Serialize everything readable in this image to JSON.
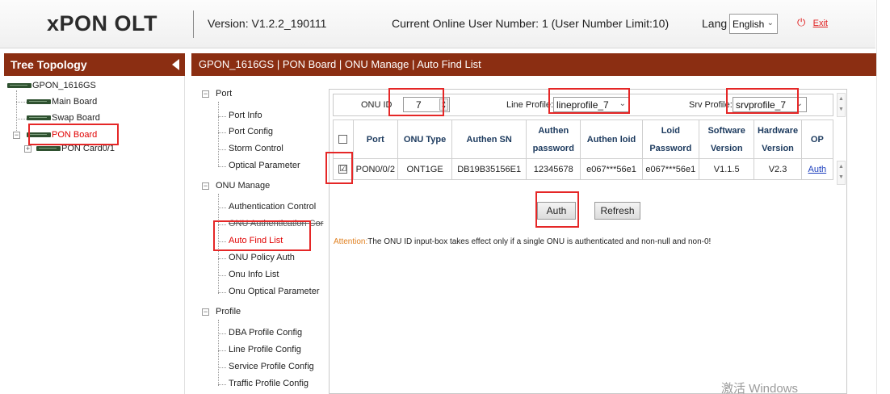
{
  "header": {
    "brand": "xPON OLT",
    "version": "Version: V1.2.2_190111",
    "online_users": "Current Online User Number: 1 (User Number Limit:10)",
    "lang_label": "Lang",
    "lang_value": "English",
    "exit_label": "Exit"
  },
  "left_panel": {
    "title": "Tree Topology",
    "tree": {
      "root": "GPON_1616GS",
      "main_board": "Main Board",
      "swap_board": "Swap Board",
      "pon_board": "PON Board",
      "pon_card": "PON Card0/1"
    }
  },
  "breadcrumb": "GPON_1616GS | PON Board | ONU Manage | Auto Find List",
  "menu": {
    "port_group": "Port",
    "port_items": [
      "Port Info",
      "Port Config",
      "Storm Control",
      "Optical Parameter"
    ],
    "onu_group": "ONU Manage",
    "onu_items": [
      "Authentication Control",
      "ONU Authentication Cor",
      "Auto Find List",
      "ONU Policy Auth",
      "Onu Info List",
      "Onu Optical Parameter"
    ],
    "profile_group": "Profile",
    "profile_items": [
      "DBA Profile Config",
      "Line Profile Config",
      "Service Profile Config",
      "Traffic Profile Config"
    ]
  },
  "params": {
    "onu_id_label": "ONU ID",
    "onu_id_value": "7",
    "line_profile_label": "Line Profile:",
    "line_profile_value": "lineprofile_7",
    "srv_profile_label": "Srv Profile:",
    "srv_profile_value": "srvprofile_7"
  },
  "table": {
    "headers": {
      "port": "Port",
      "onu_type": "ONU Type",
      "authen_sn": "Authen SN",
      "authen_password_1": "Authen",
      "authen_password_2": "password",
      "authen_loid": "Authen loid",
      "loid_password_1": "Loid",
      "loid_password_2": "Password",
      "software_version_1": "Software",
      "software_version_2": "Version",
      "hardware_version_1": "Hardware",
      "hardware_version_2": "Version",
      "op": "OP"
    },
    "rows": [
      {
        "checked": "☑",
        "port": "PON0/0/2",
        "onu_type": "ONT1GE",
        "authen_sn": "DB19B35156E1",
        "authen_password": "12345678",
        "authen_loid": "e067***56e1",
        "loid_password": "e067***56e1",
        "software_version": "V1.1.5",
        "hardware_version": "V2.3",
        "op": "Auth"
      }
    ]
  },
  "buttons": {
    "auth": "Auth",
    "refresh": "Refresh"
  },
  "attention": {
    "prefix": "Attention:",
    "text": "The ONU ID input-box takes effect only if a single ONU is authenticated and non-null and non-0!"
  },
  "watermark": "激活 Windows",
  "colors": {
    "title_bar": "#8b2e12",
    "highlight": "#e52727",
    "link": "#1a3dbd"
  }
}
